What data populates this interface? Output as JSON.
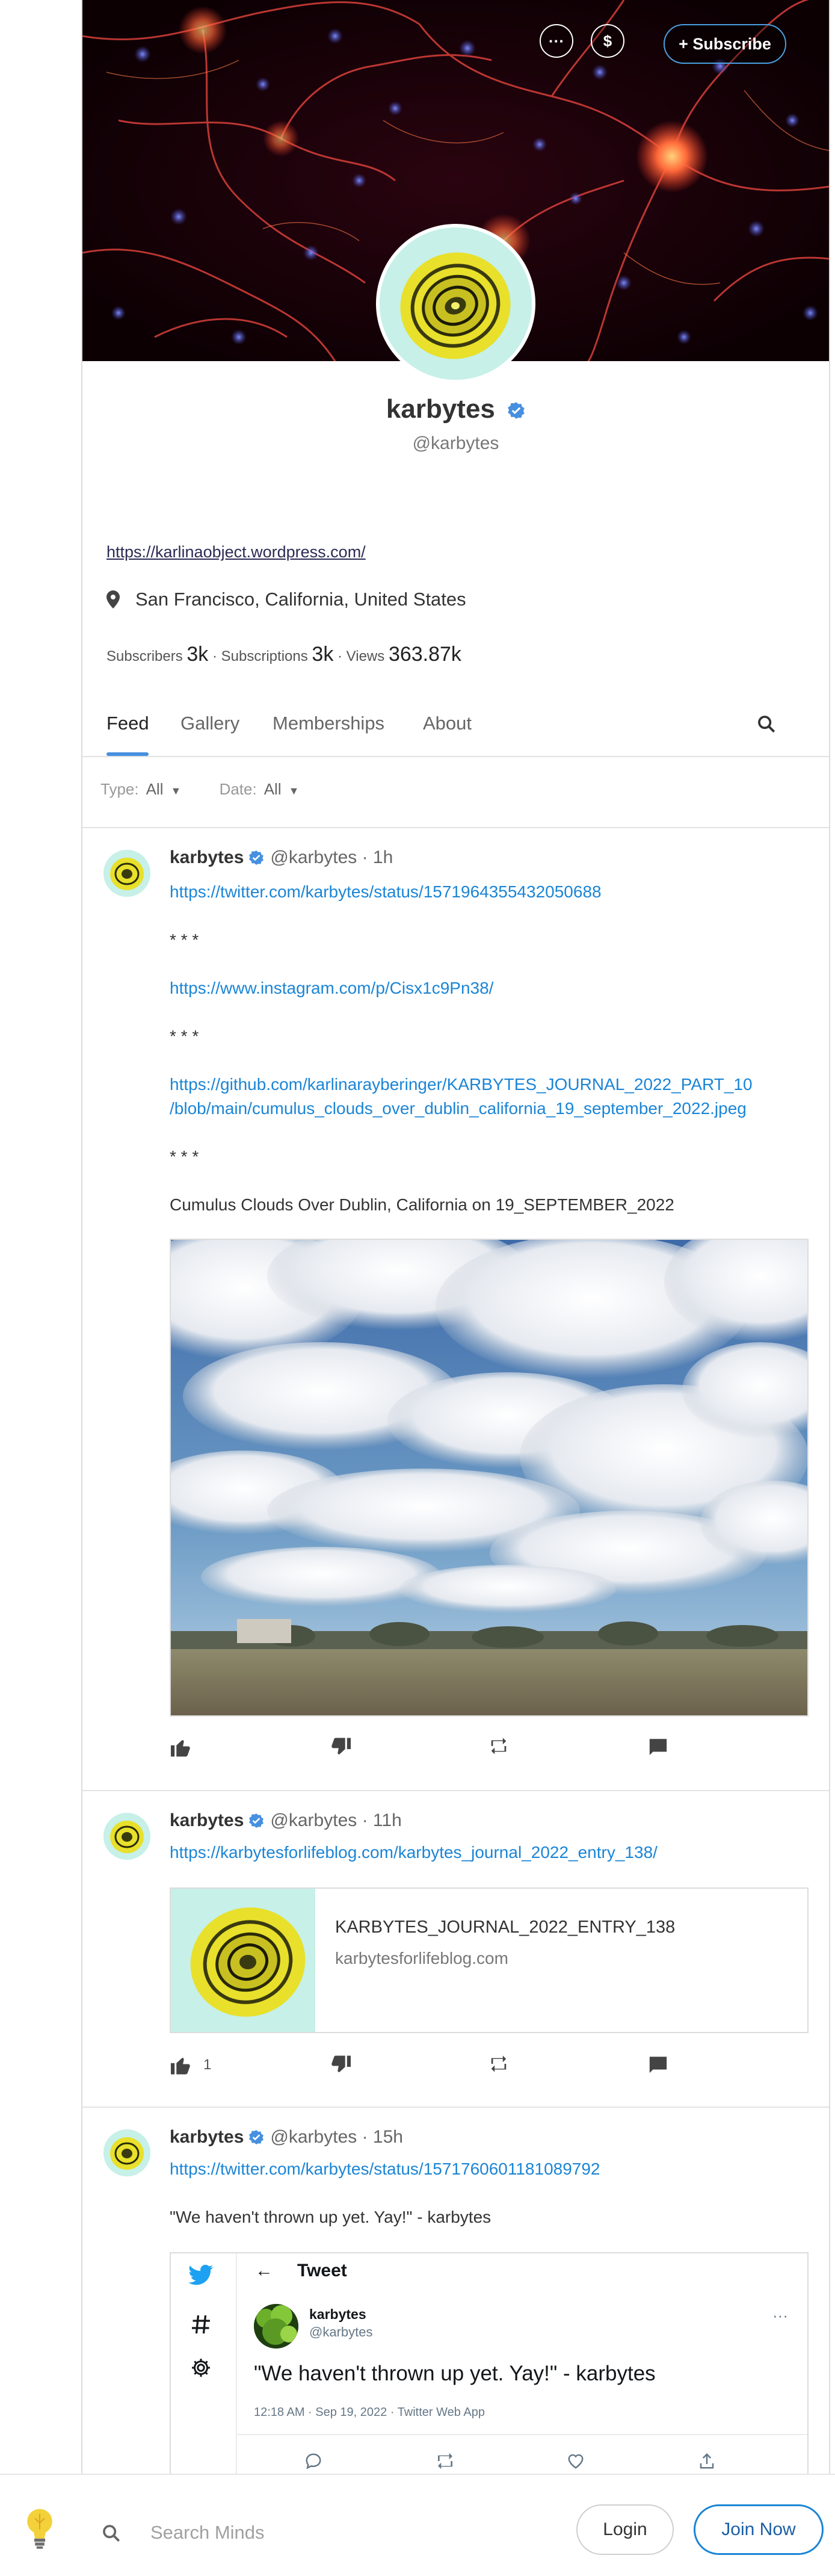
{
  "banner": {
    "more_icon": "ellipsis-icon",
    "tip_icon": "dollar-icon",
    "subscribe_label": "+ Subscribe"
  },
  "profile": {
    "name": "karbytes",
    "handle": "@karbytes",
    "link": "https://karlinaobject.wordpress.com/",
    "location": "San Francisco, California, United States",
    "stats": {
      "subscribers_label": "Subscribers",
      "subscribers": "3k",
      "subscriptions_label": "Subscriptions",
      "subscriptions": "3k",
      "views_label": "Views",
      "views": "363.87k",
      "separator": "·"
    }
  },
  "tabs": [
    {
      "label": "Feed",
      "active": true
    },
    {
      "label": "Gallery"
    },
    {
      "label": "Memberships"
    },
    {
      "label": "About"
    }
  ],
  "filters": {
    "type_label": "Type:",
    "type_value": "All",
    "date_label": "Date:",
    "date_value": "All",
    "arrow": "▼"
  },
  "posts": [
    {
      "author": "karbytes",
      "handle": "@karbytes",
      "time": "· 1h",
      "lines": [
        "https://twitter.com/karbytes/status/1571964355432050688",
        "* * *",
        "https://www.instagram.com/p/Cisx1c9Pn38/",
        "* * *",
        "https://github.com/karlinarayberinger/KARBYTES_JOURNAL_2022_PART_10",
        "/blob/main/cumulus_clouds_over_dublin_california_19_september_2022.jpeg",
        "* * *",
        "Cumulus Clouds Over Dublin, California on 19_SEPTEMBER_2022"
      ],
      "upvotes": ""
    },
    {
      "author": "karbytes",
      "handle": "@karbytes",
      "time": "· 11h",
      "link": "https://karbytesforlifeblog.com/karbytes_journal_2022_entry_138/",
      "card_title": "KARBYTES_JOURNAL_2022_ENTRY_138",
      "card_domain": "karbytesforlifeblog.com",
      "upvotes": "1"
    },
    {
      "author": "karbytes",
      "handle": "@karbytes",
      "time": "· 15h",
      "link": "https://twitter.com/karbytes/status/1571760601181089792",
      "text": "\"We haven't thrown up yet. Yay!\" - karbytes",
      "tweet": {
        "header": "Tweet",
        "back": "←",
        "name": "karbytes",
        "handle": "@karbytes",
        "dots": "···",
        "text": "\"We haven't thrown up yet. Yay!\" - karbytes",
        "meta": "12:18 AM · Sep 19, 2022 · Twitter Web App"
      }
    }
  ],
  "bottom": {
    "search_placeholder": "Search Minds",
    "login_label": "Login",
    "join_label": "Join Now"
  },
  "colors": {
    "accent": "#1b85d6",
    "tab_underline": "#4690df",
    "verified": "#4690df"
  }
}
